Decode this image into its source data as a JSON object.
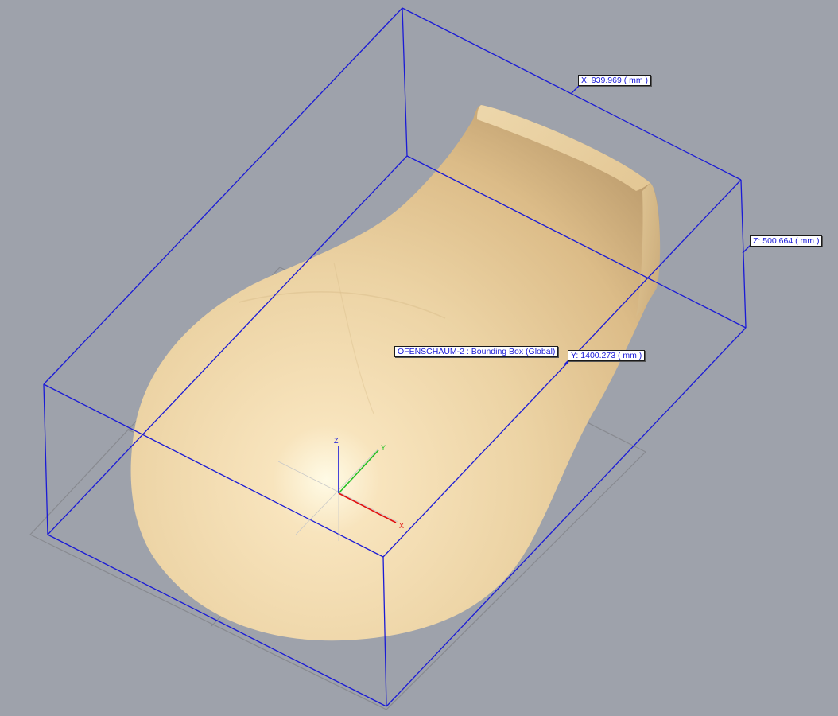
{
  "viewport": {
    "background": "#9ea2ab",
    "bounding_box_color": "#1a1ad6",
    "part_color": "#e8cfa0",
    "grid_color": "#8a8c91"
  },
  "labels": {
    "x_dimension": "X: 939.969 ( mm )",
    "y_dimension": "Y: 1400.273 ( mm )",
    "z_dimension": "Z: 500.664 ( mm )",
    "bounding_box_title": "OFENSCHAUM-2 : Bounding Box (Global)"
  },
  "triad": {
    "x": "X",
    "y": "Y",
    "z": "Z",
    "x_color": "#e01010",
    "y_color": "#22c022",
    "z_color": "#1818d8"
  }
}
